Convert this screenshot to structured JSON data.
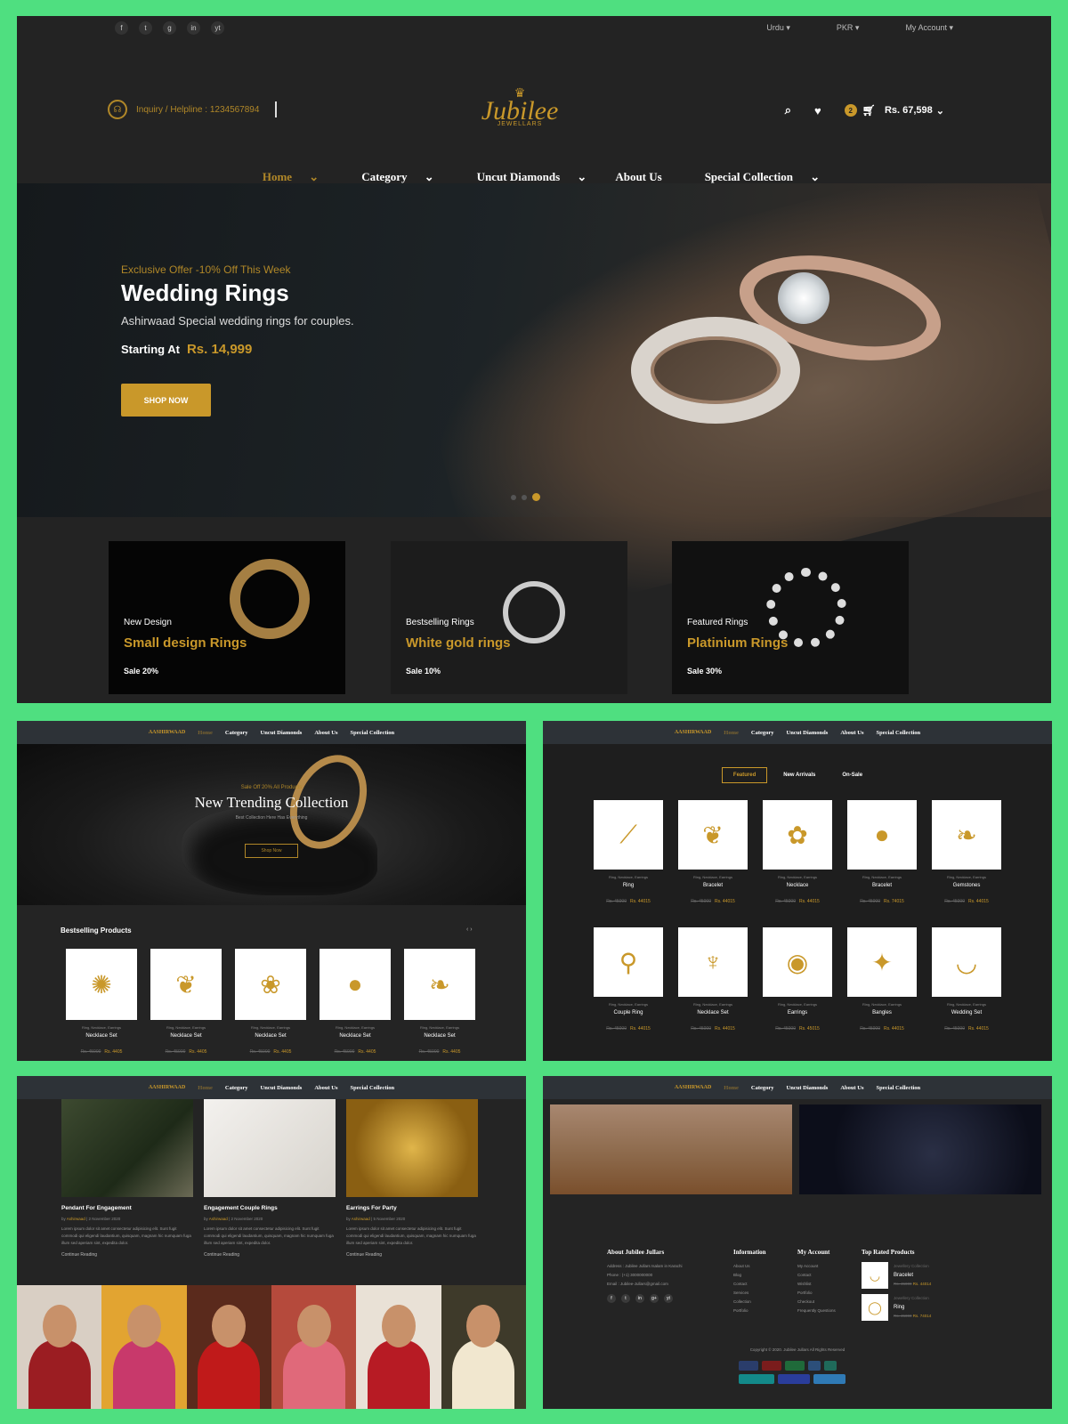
{
  "top": {
    "social": [
      "f",
      "t",
      "g",
      "in",
      "yt"
    ],
    "language": "Urdu",
    "currency": "PKR",
    "account": "My Account"
  },
  "header": {
    "helpline": "Inquiry / Helpline : 1234567894",
    "brand": "Jubilee",
    "brand_sub": "JEWELLARS",
    "cart_count": "2",
    "cart_total": "Rs. 67,598"
  },
  "nav": [
    "Home",
    "Category",
    "Uncut Diamonds",
    "About Us",
    "Special Collection"
  ],
  "hero": {
    "offer": "Exclusive Offer -10% Off This Week",
    "title": "Wedding Rings",
    "subtitle": "Ashirwaad Special wedding rings for couples.",
    "starting_label": "Starting At",
    "price": "Rs. 14,999",
    "button": "SHOP NOW"
  },
  "banners": [
    {
      "tag": "New Design",
      "name": "Small design Rings",
      "sale": "Sale 20%"
    },
    {
      "tag": "Bestselling Rings",
      "name": "White gold rings",
      "sale": "Sale 10%"
    },
    {
      "tag": "Featured Rings",
      "name": "Platinium Rings",
      "sale": "Sale 30%"
    }
  ],
  "subnav": {
    "logo": "AASHIRWAAD",
    "items": [
      "Home",
      "Category",
      "Uncut Diamonds",
      "About Us",
      "Special Collection"
    ]
  },
  "trending": {
    "small": "Sale Off 20% All Products",
    "title": "New Trending Collection",
    "sub": "Best Collection Here Has Everything",
    "button": "Shop Now",
    "section": "Bestselling Products",
    "arrows": "‹ ›",
    "products": [
      {
        "cat": "Ring, Necklace, Earrings",
        "name": "Necklace Set",
        "old": "Rs. 45000",
        "now": "Rs. 4405"
      },
      {
        "cat": "Ring, Necklace, Earrings",
        "name": "Necklace Set",
        "old": "Rs. 45000",
        "now": "Rs. 4405"
      },
      {
        "cat": "Ring, Necklace, Earrings",
        "name": "Necklace Set",
        "old": "Rs. 45000",
        "now": "Rs. 4405"
      },
      {
        "cat": "Ring, Necklace, Earrings",
        "name": "Necklace Set",
        "old": "Rs. 45000",
        "now": "Rs. 4405"
      },
      {
        "cat": "Ring, Necklace, Earrings",
        "name": "Necklace Set",
        "old": "Rs. 45000",
        "now": "Rs. 4405"
      }
    ]
  },
  "featured": {
    "tabs": [
      "Featured",
      "New Arrivals",
      "On-Sale"
    ],
    "items": [
      {
        "cat": "Ring, Necklace, Earrings",
        "name": "Ring",
        "old": "Rs. 45000",
        "now": "Rs. 44015"
      },
      {
        "cat": "Ring, Necklace, Earrings",
        "name": "Bracelet",
        "old": "Rs. 45000",
        "now": "Rs. 44015"
      },
      {
        "cat": "Ring, Necklace, Earrings",
        "name": "Necklace",
        "old": "Rs. 45000",
        "now": "Rs. 44015"
      },
      {
        "cat": "Ring, Necklace, Earrings",
        "name": "Bracelet",
        "old": "Rs. 45000",
        "now": "Rs. 74015"
      },
      {
        "cat": "Ring, Necklace, Earrings",
        "name": "Gemstones",
        "old": "Rs. 45000",
        "now": "Rs. 44015"
      },
      {
        "cat": "Ring, Necklace, Earrings",
        "name": "Couple Ring",
        "old": "Rs. 45000",
        "now": "Rs. 44015"
      },
      {
        "cat": "Ring, Necklace, Earrings",
        "name": "Necklace Set",
        "old": "Rs. 45000",
        "now": "Rs. 44015"
      },
      {
        "cat": "Ring, Necklace, Earrings",
        "name": "Earrings",
        "old": "Rs. 45000",
        "now": "Rs. 45015"
      },
      {
        "cat": "Ring, Necklace, Earrings",
        "name": "Bangles",
        "old": "Rs. 45000",
        "now": "Rs. 44015"
      },
      {
        "cat": "Ring, Necklace, Earrings",
        "name": "Wedding Set",
        "old": "Rs. 45000",
        "now": "Rs. 44015"
      }
    ]
  },
  "blog": {
    "posts": [
      {
        "title": "Pendant For Engagement",
        "by": "Ashirwaad",
        "date": "2 November 2020",
        "body": "Lorem ipsum dolor sit amet consectetur adipisicing elit. Sunt fugit commodi qui eligendi laudantium, quisquam, magnam hic numquam fuga illum sed aperiam sint, expedita dolor.",
        "more": "Continue Reading"
      },
      {
        "title": "Engagement Couple Rings",
        "by": "Ashirwaad",
        "date": "2 November 2020",
        "body": "Lorem ipsum dolor sit amet consectetur adipisicing elit. Sunt fugit commodi qui eligendi laudantium, quisquam, magnam hic numquam fuga illum sed aperiam sint, expedita dolor.",
        "more": "Continue Reading"
      },
      {
        "title": "Earrings For Party",
        "by": "Ashirwaad",
        "date": "5 November 2020",
        "body": "Lorem ipsum dolor sit amet consectetur adipisicing elit. Sunt fugit commodi qui eligendi laudantium, quisquam, magnam hic numquam fuga illum sed aperiam sint, expedita dolor.",
        "more": "Continue Reading"
      }
    ]
  },
  "footer": {
    "about_title": "About Jubilee Jullars",
    "about_lines": [
      "Address : Jubilee Jullars Isalam in Karachi",
      "Phone : (+1) 3000000000",
      "Email : Jubilee-Jullars@gmail.com"
    ],
    "social": [
      "f",
      "t",
      "in",
      "g+",
      "yt"
    ],
    "info_title": "Information",
    "info": [
      "About Us",
      "Blog",
      "Contact",
      "Services",
      "Collection",
      "Portfolio"
    ],
    "account_title": "My Account",
    "account": [
      "My Account",
      "Contact",
      "Wishlist",
      "Portfolio",
      "Checkout",
      "Frequently Questions"
    ],
    "top_title": "Top Rated Products",
    "top": [
      {
        "cat": "Jewellery Collection",
        "name": "Bracelet",
        "old": "Rs. 45000",
        "now": "Rs. 44014"
      },
      {
        "cat": "Jewellery Collection",
        "name": "Ring",
        "old": "Rs. 45000",
        "now": "Rs. 74014"
      }
    ],
    "copyright": "Copyright © 2020. Jubilee Jullars All Rights Reserved"
  },
  "colors": {
    "accent": "#c9982a",
    "bg": "#232323",
    "frame": "#4fdf80"
  }
}
